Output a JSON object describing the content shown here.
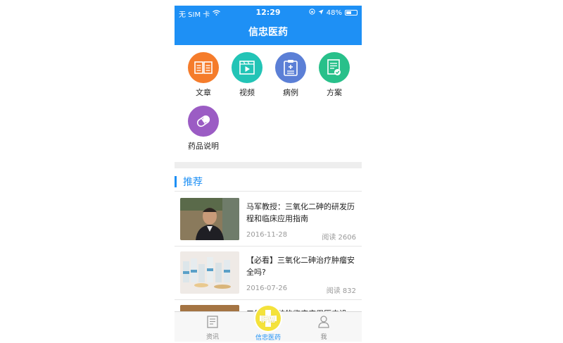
{
  "status_bar": {
    "carrier": "无 SIM 卡",
    "time": "12:29",
    "battery": "48%"
  },
  "nav": {
    "title": "信忠医药"
  },
  "categories": [
    {
      "label": "文章",
      "color": "#f57c2b",
      "icon": "book-icon"
    },
    {
      "label": "视频",
      "color": "#22c4b6",
      "icon": "video-icon"
    },
    {
      "label": "病例",
      "color": "#5b7fd6",
      "icon": "clipboard-icon"
    },
    {
      "label": "方案",
      "color": "#28c08a",
      "icon": "plan-icon"
    },
    {
      "label": "药品说明",
      "color": "#9b5cc4",
      "icon": "pill-icon"
    }
  ],
  "recommend": {
    "title": "推荐",
    "items": [
      {
        "title": "马军教授：三氧化二砷的研发历程和临床应用指南",
        "date": "2016-11-28",
        "reads": "阅读 2606"
      },
      {
        "title": "【必看】三氧化二砷治疗肿瘤安全吗?",
        "date": "2016-07-26",
        "reads": "阅读 832"
      },
      {
        "title": "三氧化二砷的临床应用历史沿",
        "date": "",
        "reads": ""
      }
    ]
  },
  "tabbar": {
    "tabs": [
      {
        "label": "资讯",
        "icon": "news-icon"
      },
      {
        "label": "信忠医药",
        "icon": "liver-cancer-badge",
        "badge": "肝癌"
      },
      {
        "label": "我",
        "icon": "user-icon"
      }
    ]
  },
  "colors": {
    "primary": "#1e90f5",
    "badge": "#f4e23b"
  }
}
